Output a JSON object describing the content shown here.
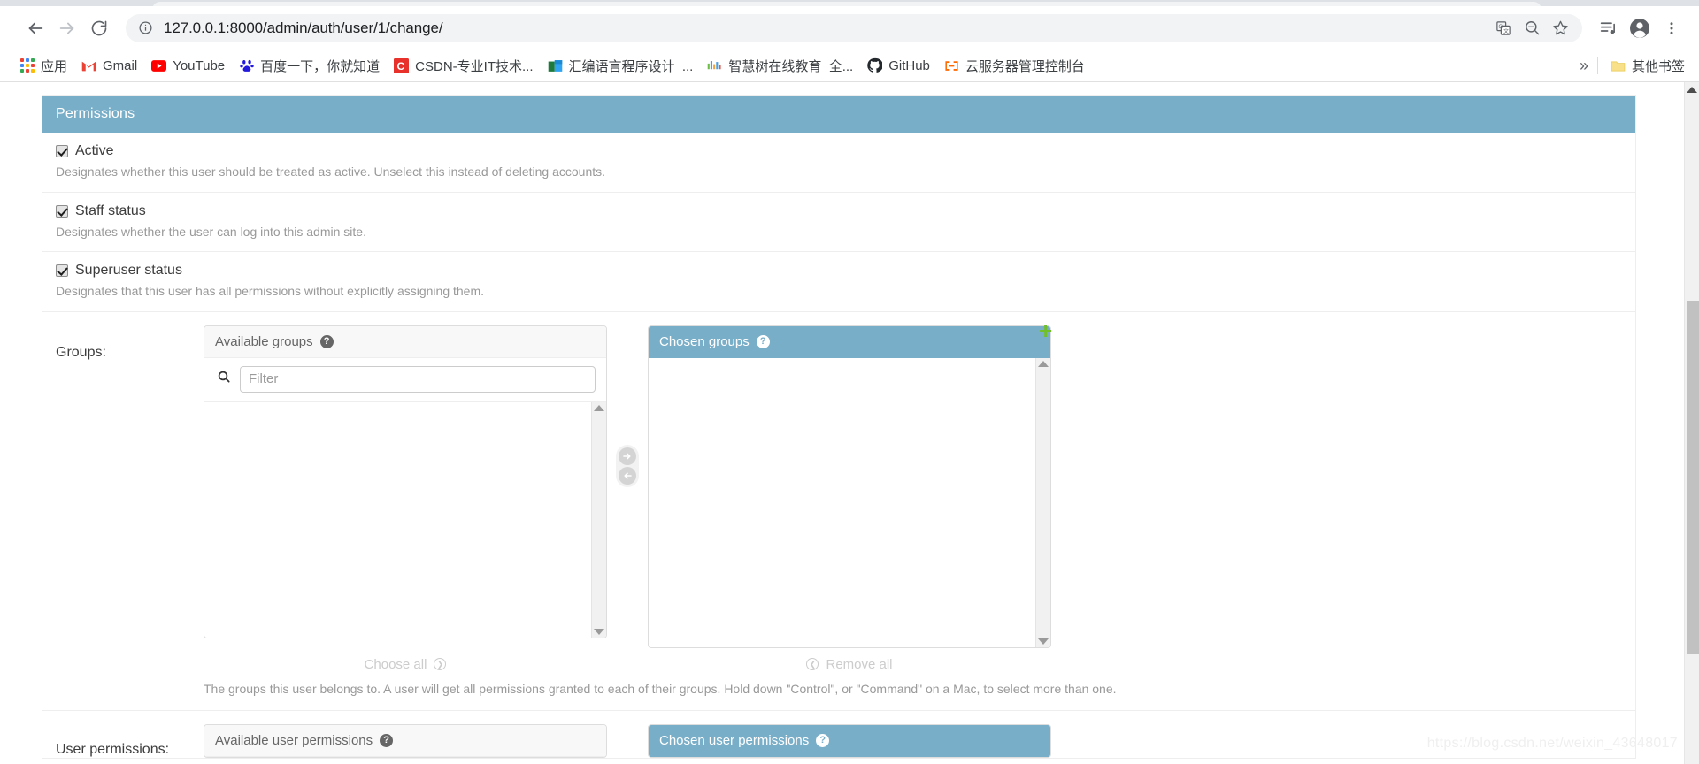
{
  "browser": {
    "url": "127.0.0.1:8000/admin/auth/user/1/change/",
    "nav": {
      "back_label": "Back",
      "forward_label": "Forward",
      "reload_label": "Reload"
    },
    "omnibox_icons": [
      "site-info-icon",
      "translate-icon",
      "zoom-out-icon",
      "bookmark-star-icon"
    ],
    "toolbar_icons": [
      "media-playlist-icon",
      "profile-avatar-icon",
      "chrome-menu-icon"
    ],
    "bookmarks": [
      {
        "label": "应用",
        "icon": "apps-grid-icon"
      },
      {
        "label": "Gmail",
        "icon": "gmail-icon"
      },
      {
        "label": "YouTube",
        "icon": "youtube-icon"
      },
      {
        "label": "百度一下，你就知道",
        "icon": "baidu-icon"
      },
      {
        "label": "CSDN-专业IT技术...",
        "icon": "csdn-icon"
      },
      {
        "label": "汇编语言程序设计_...",
        "icon": "book-icon"
      },
      {
        "label": "智慧树在线教育_全...",
        "icon": "zhihuishu-icon"
      },
      {
        "label": "GitHub",
        "icon": "github-icon"
      },
      {
        "label": "云服务器管理控制台",
        "icon": "aliyun-icon"
      }
    ],
    "overflow_label": "»",
    "other_bookmarks": {
      "label": "其他书签",
      "icon": "folder-icon"
    }
  },
  "page": {
    "module_title": "Permissions",
    "checkboxes": [
      {
        "label": "Active",
        "checked": true,
        "help": "Designates whether this user should be treated as active. Unselect this instead of deleting accounts."
      },
      {
        "label": "Staff status",
        "checked": true,
        "help": "Designates whether the user can log into this admin site."
      },
      {
        "label": "Superuser status",
        "checked": true,
        "help": "Designates that this user has all permissions without explicitly assigning them."
      }
    ],
    "groups_row": {
      "label": "Groups:",
      "available_title": "Available groups",
      "available_help_icon": "question-mark-icon",
      "filter_placeholder": "Filter",
      "filter_value": "",
      "search_icon": "search-icon",
      "available_items": [],
      "chosen_title": "Chosen groups",
      "chosen_help_icon": "question-mark-icon",
      "chosen_items": [],
      "add_icon": "plus-icon",
      "choose_all_label": "Choose all",
      "remove_all_label": "Remove all",
      "move_right_icon": "arrow-right-circle-icon",
      "move_left_icon": "arrow-left-circle-icon",
      "help": "The groups this user belongs to. A user will get all permissions granted to each of their groups. Hold down \"Control\", or \"Command\" on a Mac, to select more than one."
    },
    "permissions_row": {
      "label": "User permissions:",
      "available_title": "Available user permissions",
      "chosen_title": "Chosen user permissions"
    },
    "watermark": "https://blog.csdn.net/weixin_43648017"
  },
  "colors": {
    "accent": "#79aec8",
    "plus_green": "#70bf2b",
    "muted_text": "#999999",
    "chrome_icon": "#5f6368"
  }
}
